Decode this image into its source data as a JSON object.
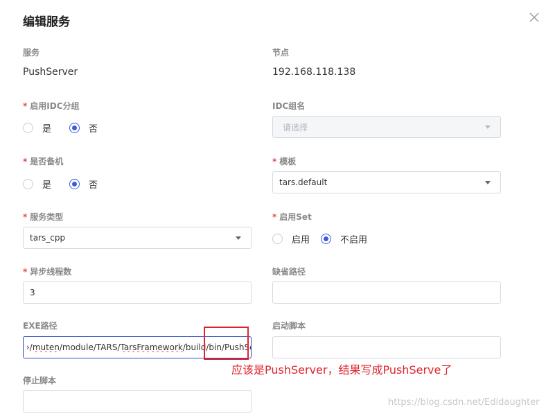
{
  "dialog": {
    "title": "编辑服务"
  },
  "service": {
    "label": "服务",
    "value": "PushServer"
  },
  "node": {
    "label": "节点",
    "value": "192.168.118.138"
  },
  "enable_idc": {
    "label": "启用IDC分组",
    "options": [
      "是",
      "否"
    ],
    "selected": "否"
  },
  "idc_group": {
    "label": "IDC组名",
    "placeholder": "请选择"
  },
  "is_backup": {
    "label": "是否备机",
    "options": [
      "是",
      "否"
    ],
    "selected": "否"
  },
  "template": {
    "label": "模板",
    "value": "tars.default"
  },
  "service_type": {
    "label": "服务类型",
    "value": "tars_cpp"
  },
  "enable_set": {
    "label": "启用Set",
    "options": [
      "启用",
      "不启用"
    ],
    "selected": "不启用"
  },
  "async_threads": {
    "label": "异步线程数",
    "value": "3"
  },
  "default_path": {
    "label": "缺省路径",
    "value": ""
  },
  "exe_path": {
    "label": "EXE路径",
    "value_prefix": "›/",
    "seg1": "muten",
    "mid1": "/module/TARS/",
    "seg2": "TarsFramework",
    "mid2": "/build/bin/",
    "seg3": "PushServe"
  },
  "start_script": {
    "label": "启动脚本",
    "value": ""
  },
  "stop_script": {
    "label": "停止脚本",
    "value": ""
  },
  "required_mark": "*",
  "annotation": "应该是PushServer，结果写成PushServe了",
  "watermark": "https://blog.csdn.net/Edidaughter",
  "colors": {
    "accent": "#3b5bdb",
    "required": "#e5484d",
    "annotation": "#e0242c"
  }
}
